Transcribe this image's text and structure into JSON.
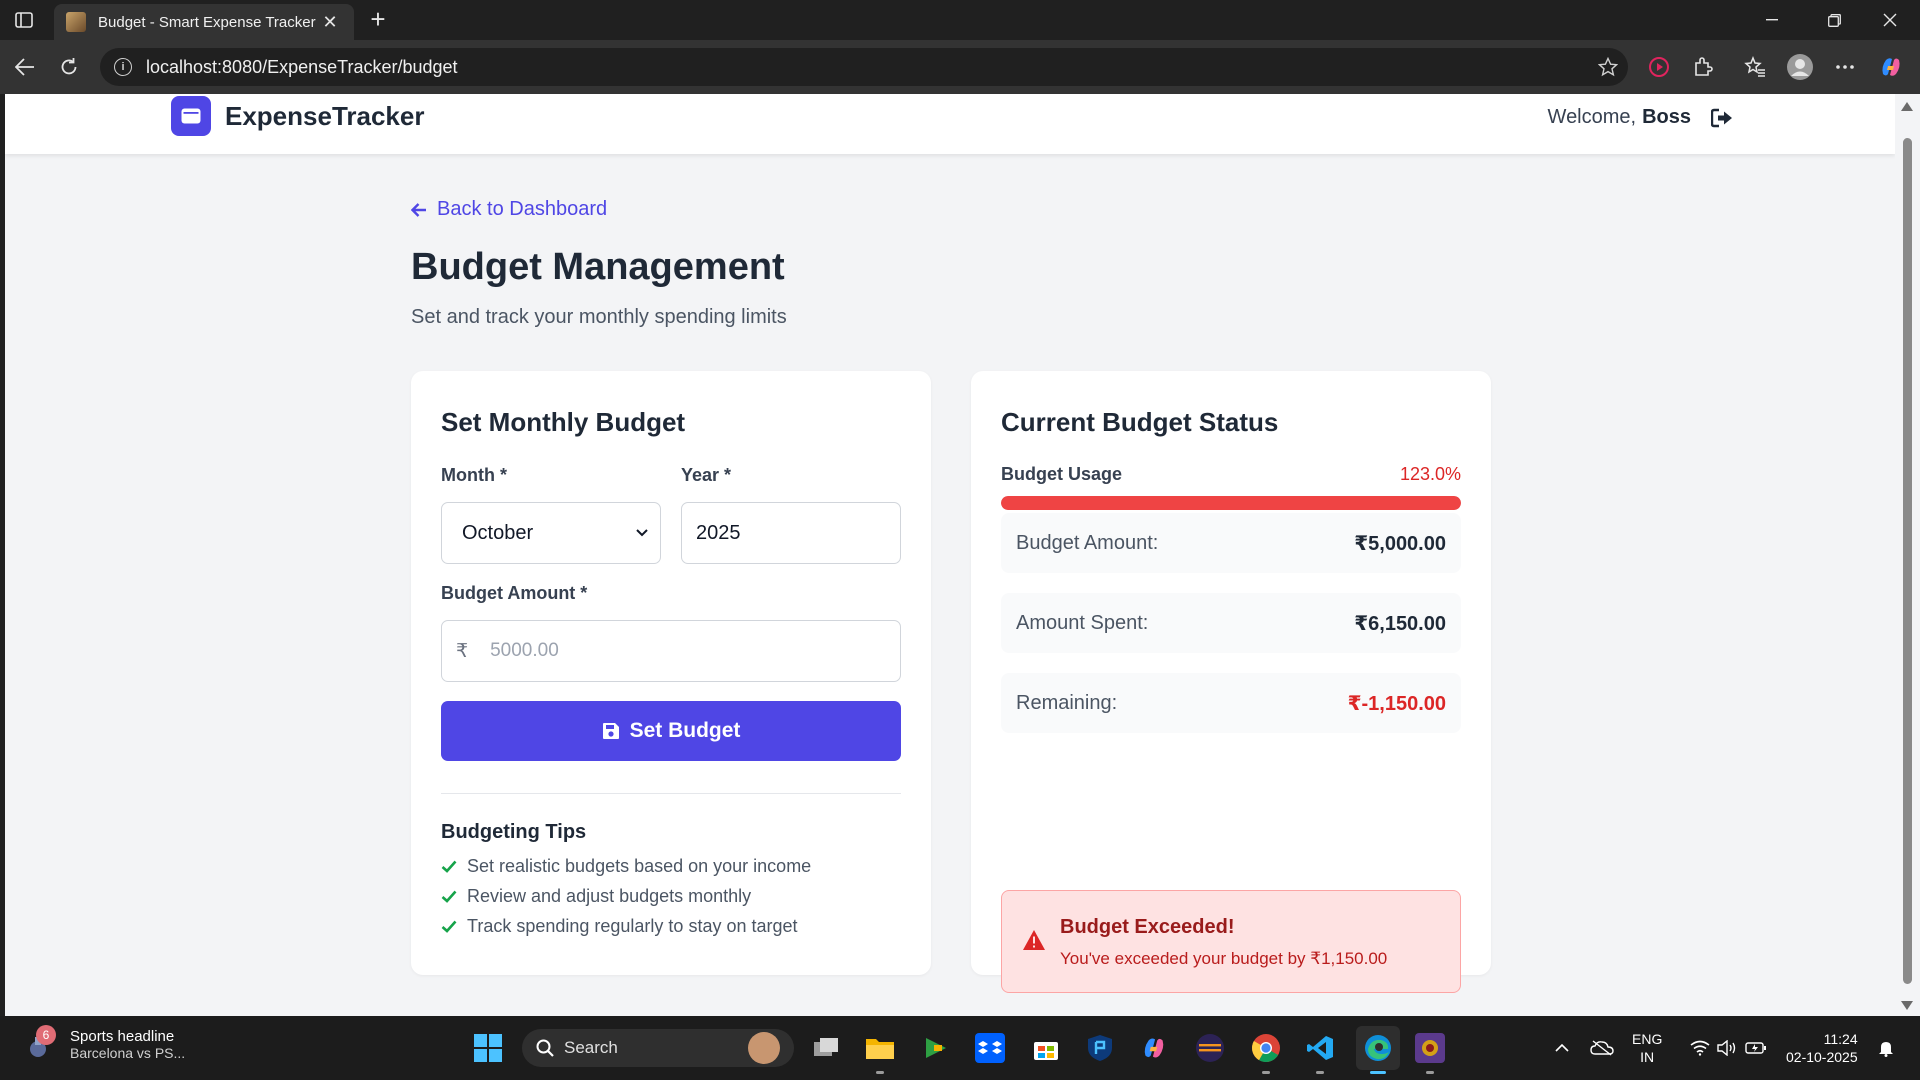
{
  "browser": {
    "tab_title": "Budget - Smart Expense Tracker",
    "url": "localhost:8080/ExpenseTracker/budget"
  },
  "header": {
    "brand": "ExpenseTracker",
    "welcome_prefix": "Welcome,",
    "username": "Boss"
  },
  "page": {
    "back_link": "Back to Dashboard",
    "title": "Budget Management",
    "subtitle": "Set and track your monthly spending limits"
  },
  "form": {
    "title": "Set Monthly Budget",
    "month_label": "Month *",
    "month_value": "October",
    "year_label": "Year *",
    "year_value": "2025",
    "amount_label": "Budget Amount *",
    "currency_symbol": "₹",
    "amount_placeholder": "5000.00",
    "submit_label": "Set Budget"
  },
  "tips": {
    "title": "Budgeting Tips",
    "items": [
      "Set realistic budgets based on your income",
      "Review and adjust budgets monthly",
      "Track spending regularly to stay on target"
    ]
  },
  "status": {
    "title": "Current Budget Status",
    "usage_label": "Budget Usage",
    "usage_percent_text": "123.0%",
    "usage_fill_fraction": 1.0,
    "rows": [
      {
        "label": "Budget Amount:",
        "value": "₹5,000.00",
        "negative": false
      },
      {
        "label": "Amount Spent:",
        "value": "₹6,150.00",
        "negative": false
      },
      {
        "label": "Remaining:",
        "value": "₹-1,150.00",
        "negative": true
      }
    ],
    "alert_title": "Budget Exceeded!",
    "alert_text": "You've exceeded your budget by ₹1,150.00"
  },
  "taskbar": {
    "news_badge": "6",
    "news_title": "Sports headline",
    "news_subtitle": "Barcelona vs PS...",
    "search_label": "Search",
    "lang_line1": "ENG",
    "lang_line2": "IN",
    "time": "11:24",
    "date": "02-10-2025"
  },
  "colors": {
    "primary": "#4f46e5",
    "danger": "#ef4444",
    "success": "#16a34a"
  }
}
